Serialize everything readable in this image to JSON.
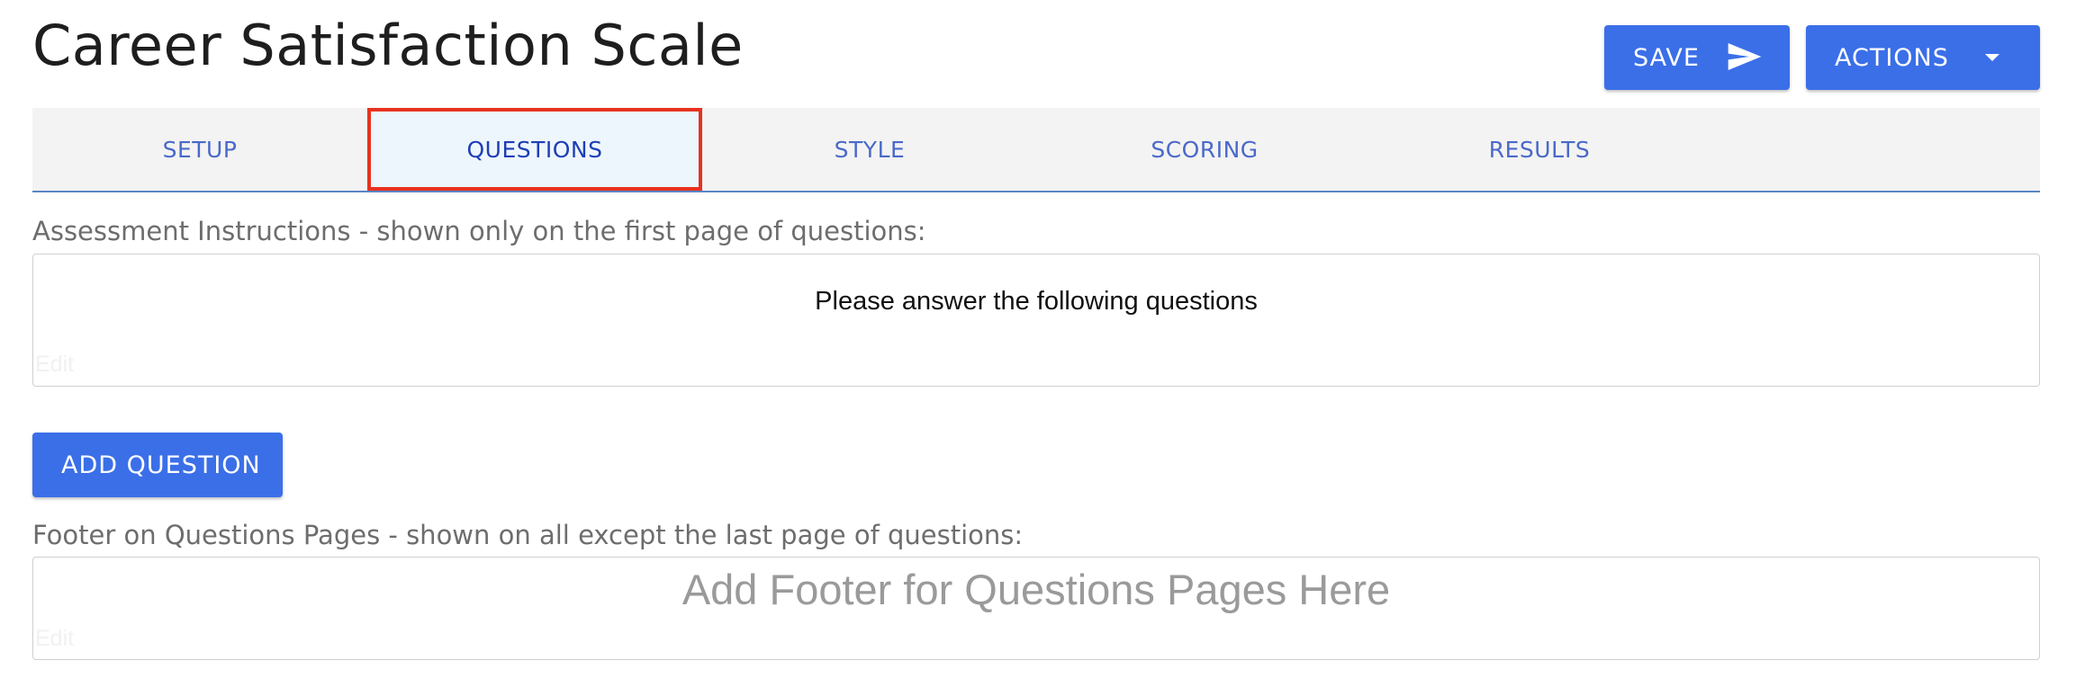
{
  "header": {
    "title": "Career Satisfaction Scale",
    "save_label": "SAVE",
    "actions_label": "ACTIONS"
  },
  "tabs": [
    {
      "label": "SETUP",
      "active": false
    },
    {
      "label": "QUESTIONS",
      "active": true
    },
    {
      "label": "STYLE",
      "active": false
    },
    {
      "label": "SCORING",
      "active": false
    },
    {
      "label": "RESULTS",
      "active": false
    }
  ],
  "instructions": {
    "label": "Assessment Instructions - shown only on the first page of questions:",
    "text": "Please answer the following questions",
    "edit_hint": "Edit"
  },
  "add_question_label": "ADD QUESTION",
  "footer": {
    "label": "Footer on Questions Pages - shown on all except the last page of questions:",
    "placeholder": "Add Footer for Questions Pages Here",
    "edit_hint": "Edit"
  },
  "colors": {
    "primary": "#3b6fe8",
    "tab_text": "#4a69c9",
    "active_tab_bg": "#eef6fd",
    "highlight_border": "#e8321f"
  },
  "icons": {
    "save": "send-icon",
    "actions": "caret-down-icon"
  }
}
